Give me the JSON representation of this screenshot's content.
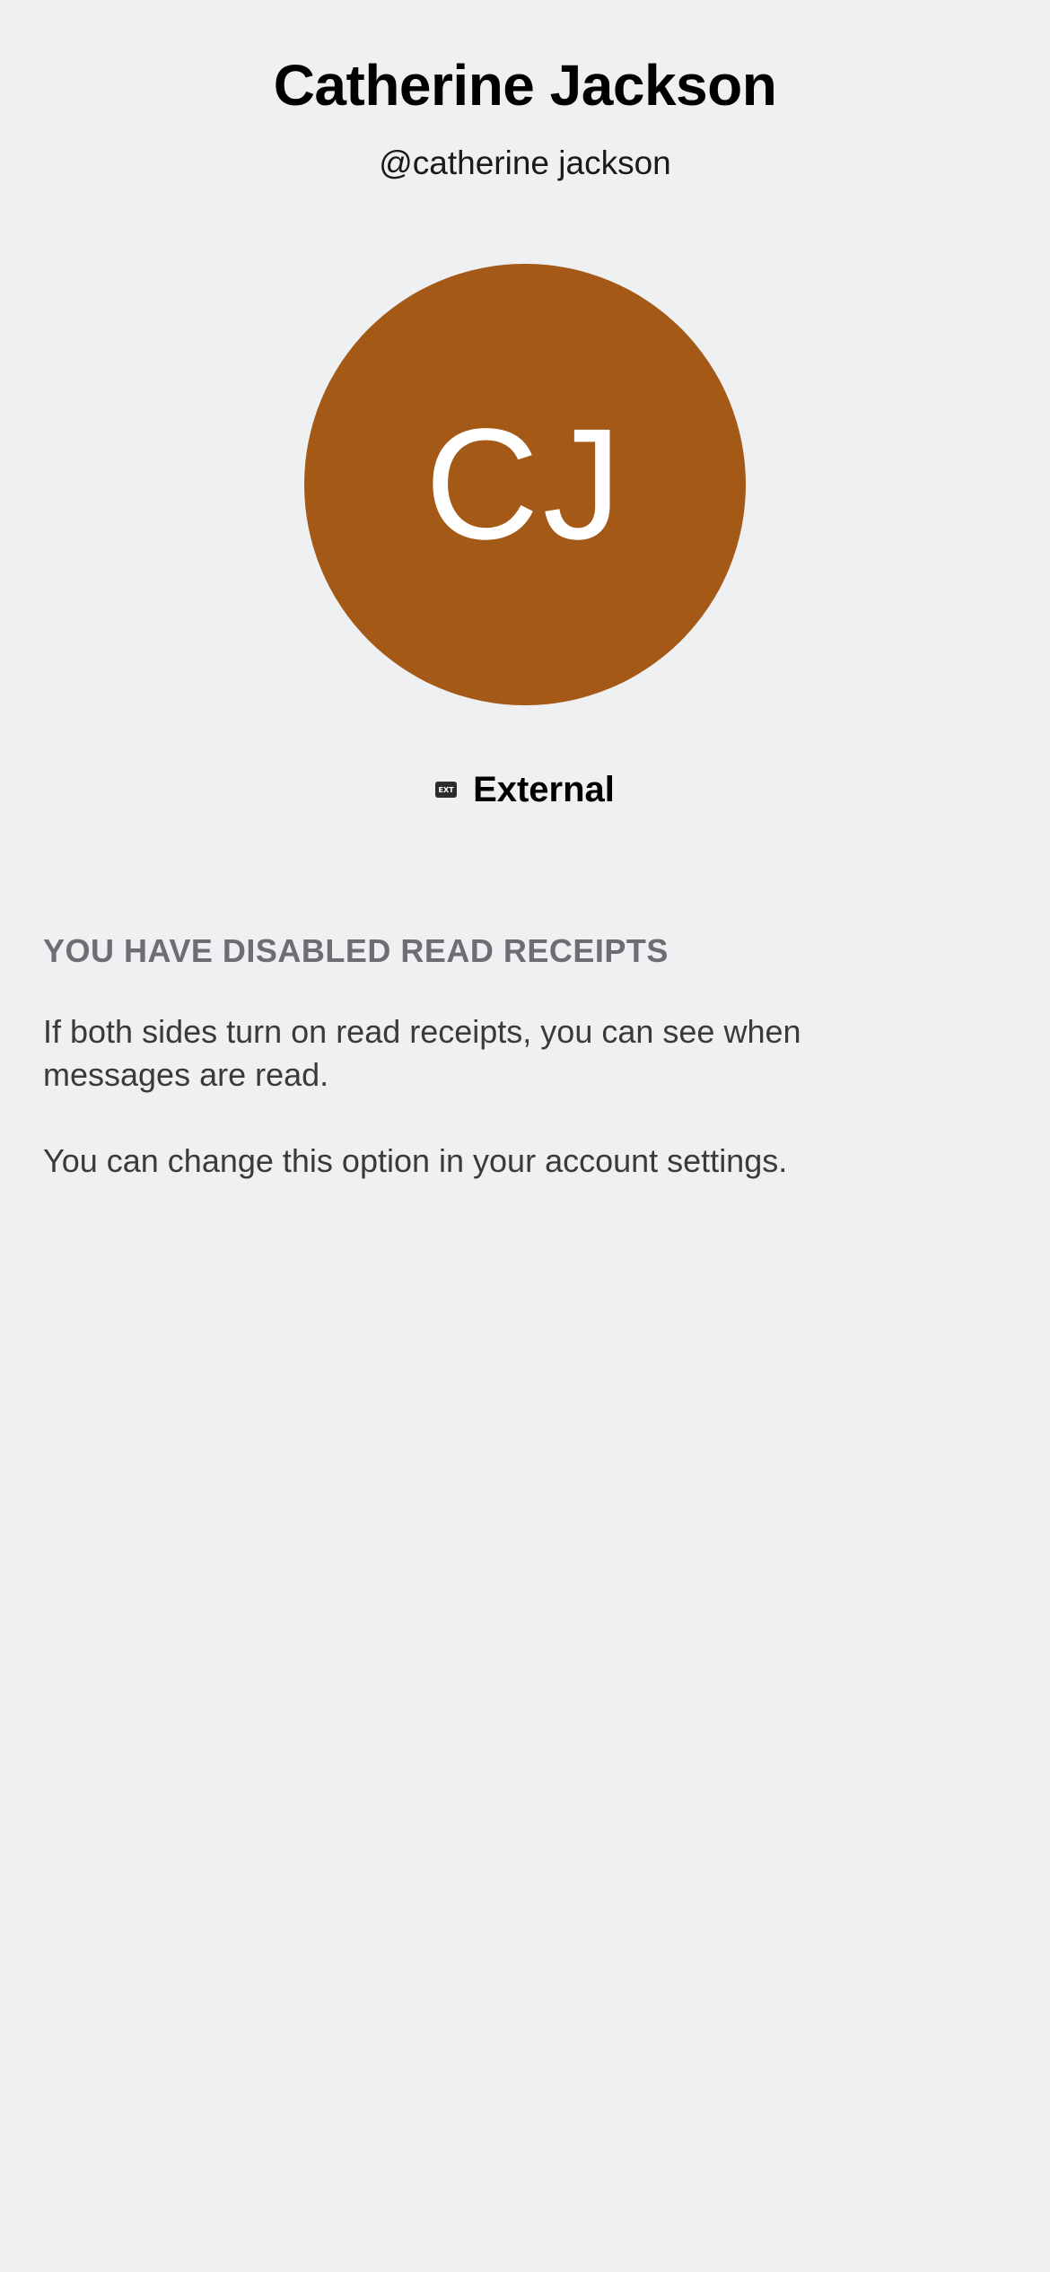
{
  "profile": {
    "name": "Catherine Jackson",
    "handle": "@catherine jackson",
    "initials": "CJ",
    "avatar_color": "#a45916",
    "badge_icon": "external-badge-icon",
    "badge_icon_text": "EXT",
    "badge_label": "External"
  },
  "read_receipts": {
    "title": "YOU HAVE DISABLED READ RECEIPTS",
    "body": "If both sides turn on read receipts, you can see when messages are read.",
    "note": "You can change this option in your account settings."
  }
}
